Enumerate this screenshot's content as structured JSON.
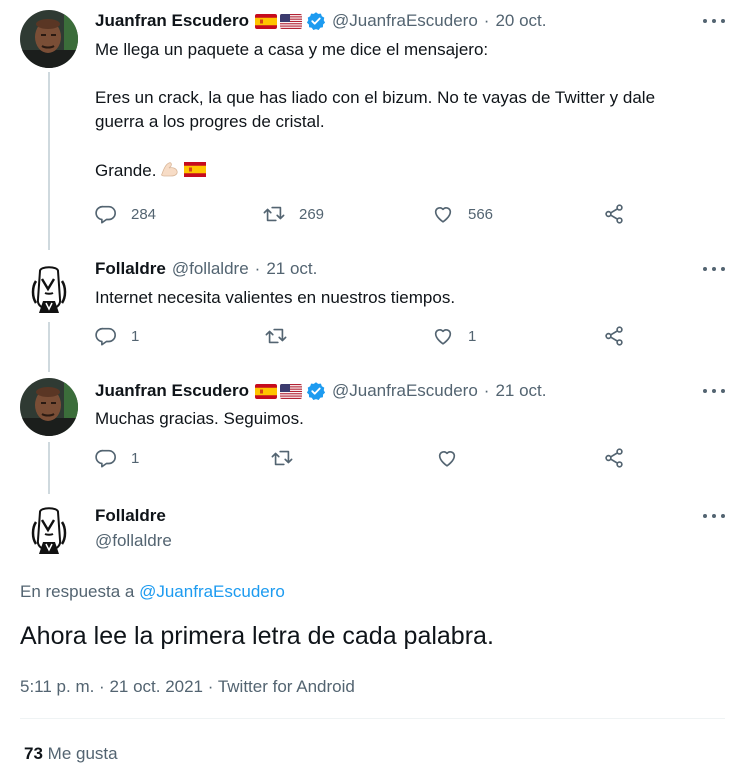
{
  "tweets": [
    {
      "name": "Juanfran Escudero",
      "handle": "@JuanfraEscudero",
      "sep": "·",
      "date": "20 oct.",
      "text": [
        "Me llega un paquete a casa y me dice el mensajero:",
        "Eres un crack, la que has liado con el bizum. No te vayas de Twitter y dale",
        "guerra a los progres de cristal.",
        "Grande."
      ],
      "emojis": [
        "flexed-biceps-emoji",
        "spain-flag-emoji"
      ],
      "replies": "284",
      "retweets": "269",
      "likes": "566"
    },
    {
      "name": "Follaldre",
      "handle": "@follaldre",
      "sep": "·",
      "date": "21 oct.",
      "text": [
        "Internet necesita valientes en nuestros tiempos."
      ],
      "replies": "1",
      "retweets": "",
      "likes": "1"
    },
    {
      "name": "Juanfran Escudero",
      "handle": "@JuanfraEscudero",
      "sep": "·",
      "date": "21 oct.",
      "text": [
        "Muchas gracias. Seguimos."
      ],
      "replies": "1",
      "retweets": "",
      "likes": ""
    }
  ],
  "main": {
    "name": "Follaldre",
    "handle": "@follaldre",
    "reply_prefix": "En respuesta a",
    "reply_handle": "@JuanfraEscudero",
    "text": "Ahora lee la primera letra de cada palabra.",
    "meta": "5:11 p. m. · 21 oct. 2021 · Twitter for Android",
    "likes_count": "73",
    "likes_label": "Me gusta"
  },
  "icons": {
    "more": "more-dots-icon",
    "verified": "verified-badge-icon",
    "reply": "reply-icon",
    "retweet": "retweet-icon",
    "like": "heart-icon",
    "share": "share-icon"
  },
  "colors": {
    "link": "#1d9bf0",
    "secondary": "#536471",
    "thread_line": "#cfd9de"
  }
}
